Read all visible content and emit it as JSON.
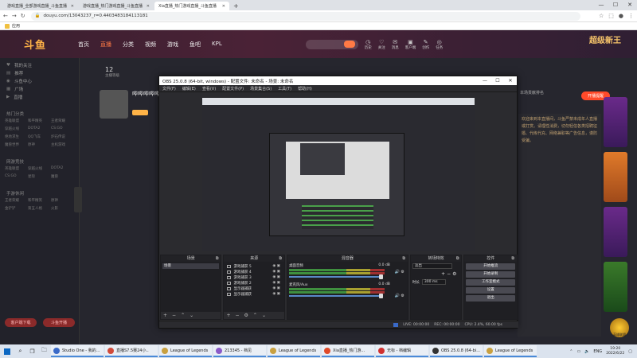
{
  "browser": {
    "tabs": [
      {
        "label": "游戏直播_全部游戏直播_斗鱼直播",
        "active": false
      },
      {
        "label": "游戏直播_热门游戏直播_斗鱼直播",
        "active": false
      },
      {
        "label": "Xia直播_热门游戏直播_斗鱼直播",
        "active": true
      }
    ],
    "new_tab": "+",
    "url": "douyu.com/13043237_r=0.4403483184113181",
    "bookmark": "应用"
  },
  "douyu": {
    "logo": "斗鱼",
    "menu": [
      "首页",
      "直播",
      "分类",
      "视频",
      "游戏",
      "鱼吧",
      "KPL"
    ],
    "active_menu": "直播",
    "banner": "超级新王",
    "top_icons": [
      "历史",
      "关注",
      "消息",
      "客户端",
      "创作",
      "任务"
    ],
    "sidebar_items": [
      "我的关注",
      "推荐",
      "斗鱼中心",
      "广场",
      "直播"
    ],
    "sidebar_head1": "热门分类",
    "sidebar_grid1": [
      "英雄联盟",
      "和平精英",
      "王者荣耀",
      "穿越火线",
      "DOTA2",
      "CS:GO",
      "绝地求生",
      "QQ飞车",
      "炉石传说",
      "魔兽世界",
      "原神",
      "主机游戏"
    ],
    "sidebar_head2": "网游竞技",
    "sidebar_grid2": [
      "英雄联盟",
      "穿越火线",
      "DOTA2",
      "CS:GO",
      "星际",
      "魔兽"
    ],
    "sidebar_head3": "手游休闲",
    "sidebar_grid3": [
      "王者荣耀",
      "和平精英",
      "原神",
      "金铲铲",
      "第五人格",
      "火影"
    ],
    "sidebar_btns": [
      "客户端下载",
      "斗鱼开播"
    ],
    "room_name": "哔哔哔哔哔",
    "counter_value": "12",
    "counter_label": "主播等级",
    "red_badge": "开播提醒",
    "right_top": "本场贡献排名",
    "right_text": "欢迎来到本直播间，斗鱼严禁未成年人直播或打赏。请理性消费，切勿轻信各类招聘征婚、代练代充、网络兼职等广告信息，谨防受骗。",
    "game_icon_label": "英雄联盟"
  },
  "obs": {
    "title": "OBS 25.0.8 (64-bit, windows) - 配置文件: 未命名 - 场景: 未命名",
    "menu": [
      "文件(F)",
      "编辑(E)",
      "查看(V)",
      "配置文件(P)",
      "场景集合(S)",
      "工具(T)",
      "帮助(H)"
    ],
    "docks": {
      "scenes": "场景",
      "sources": "来源",
      "mixer": "混音器",
      "transitions": "转场特效",
      "controls": "控件"
    },
    "scene_item": "场景",
    "source_items": [
      "游戏捕获 5",
      "游戏捕获 4",
      "游戏捕获 3",
      "游戏捕获 2",
      "显示器捕获",
      "显示器捕获"
    ],
    "mixer_channels": [
      {
        "name": "桌面音频",
        "db": "0.0 dB"
      },
      {
        "name": "麦克风/Aux",
        "db": "0.0 dB"
      }
    ],
    "transition": {
      "type": "淡出",
      "duration_label": "时长",
      "duration_value": "300 ms"
    },
    "controls": [
      "开始推流",
      "开始录制",
      "工作室模式",
      "设置",
      "退出"
    ],
    "status": {
      "live": "LIVE: 00:00:00",
      "rec": "REC: 00:00:00",
      "cpu": "CPU: 2.4%, 60.00 fps"
    }
  },
  "taskbar": {
    "apps": [
      {
        "label": "Studio One - 我的...",
        "color": "#3a6ac8"
      },
      {
        "label": "直播S7.5赛24小..",
        "color": "#d04a3a"
      },
      {
        "label": "League of Legends",
        "color": "#c8a040"
      },
      {
        "label": "213345 - 档见",
        "color": "#8a5ac8"
      },
      {
        "label": "League of Legends",
        "color": "#c8a040"
      },
      {
        "label": "Xia直播_热门游...",
        "color": "#e04a2a"
      },
      {
        "label": "无标 - 档编辑",
        "color": "#d03030"
      },
      {
        "label": "OBS 25.0.8 (64-bi...",
        "color": "#333333"
      },
      {
        "label": "League of Legends",
        "color": "#c8a040"
      }
    ],
    "tray_lang": "ENG",
    "time": "19:20",
    "date": "2022/6/22"
  }
}
